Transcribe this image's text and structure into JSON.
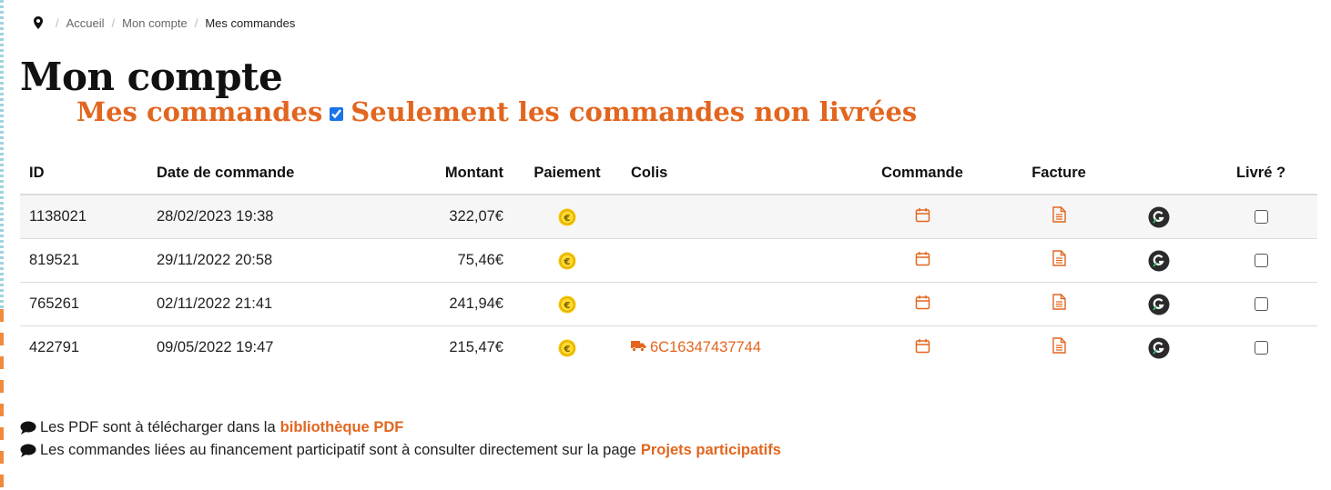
{
  "breadcrumb": {
    "icon": "map-pin-icon",
    "items": [
      "Accueil",
      "Mon compte",
      "Mes commandes"
    ]
  },
  "page": {
    "title": "Mon compte",
    "subtitle": "Mes commandes",
    "filter_label": "Seulement les commandes non livrées",
    "filter_checked": true
  },
  "colors": {
    "accent": "#e2661f",
    "title": "#111111"
  },
  "table": {
    "headers": {
      "id": "ID",
      "date": "Date de commande",
      "amount": "Montant",
      "payment": "Paiement",
      "parcel": "Colis",
      "order": "Commande",
      "invoice": "Facture",
      "delivered": "Livré ?"
    },
    "rows": [
      {
        "id": "1138021",
        "date": "28/02/2023 19:38",
        "amount": "322,07€",
        "parcel": "",
        "delivered": false
      },
      {
        "id": "819521",
        "date": "29/11/2022 20:58",
        "amount": "75,46€",
        "parcel": "",
        "delivered": false
      },
      {
        "id": "765261",
        "date": "02/11/2022 21:41",
        "amount": "241,94€",
        "parcel": "",
        "delivered": false
      },
      {
        "id": "422791",
        "date": "09/05/2022 19:47",
        "amount": "215,47€",
        "parcel": "6C16347437744",
        "delivered": false
      }
    ]
  },
  "notes": {
    "pdf_text": "Les PDF sont à télécharger dans la",
    "pdf_link": "bibliothèque PDF",
    "crowd_text": "Les commandes liées au financement participatif sont à consulter directement sur la page",
    "crowd_link": "Projets participatifs"
  }
}
